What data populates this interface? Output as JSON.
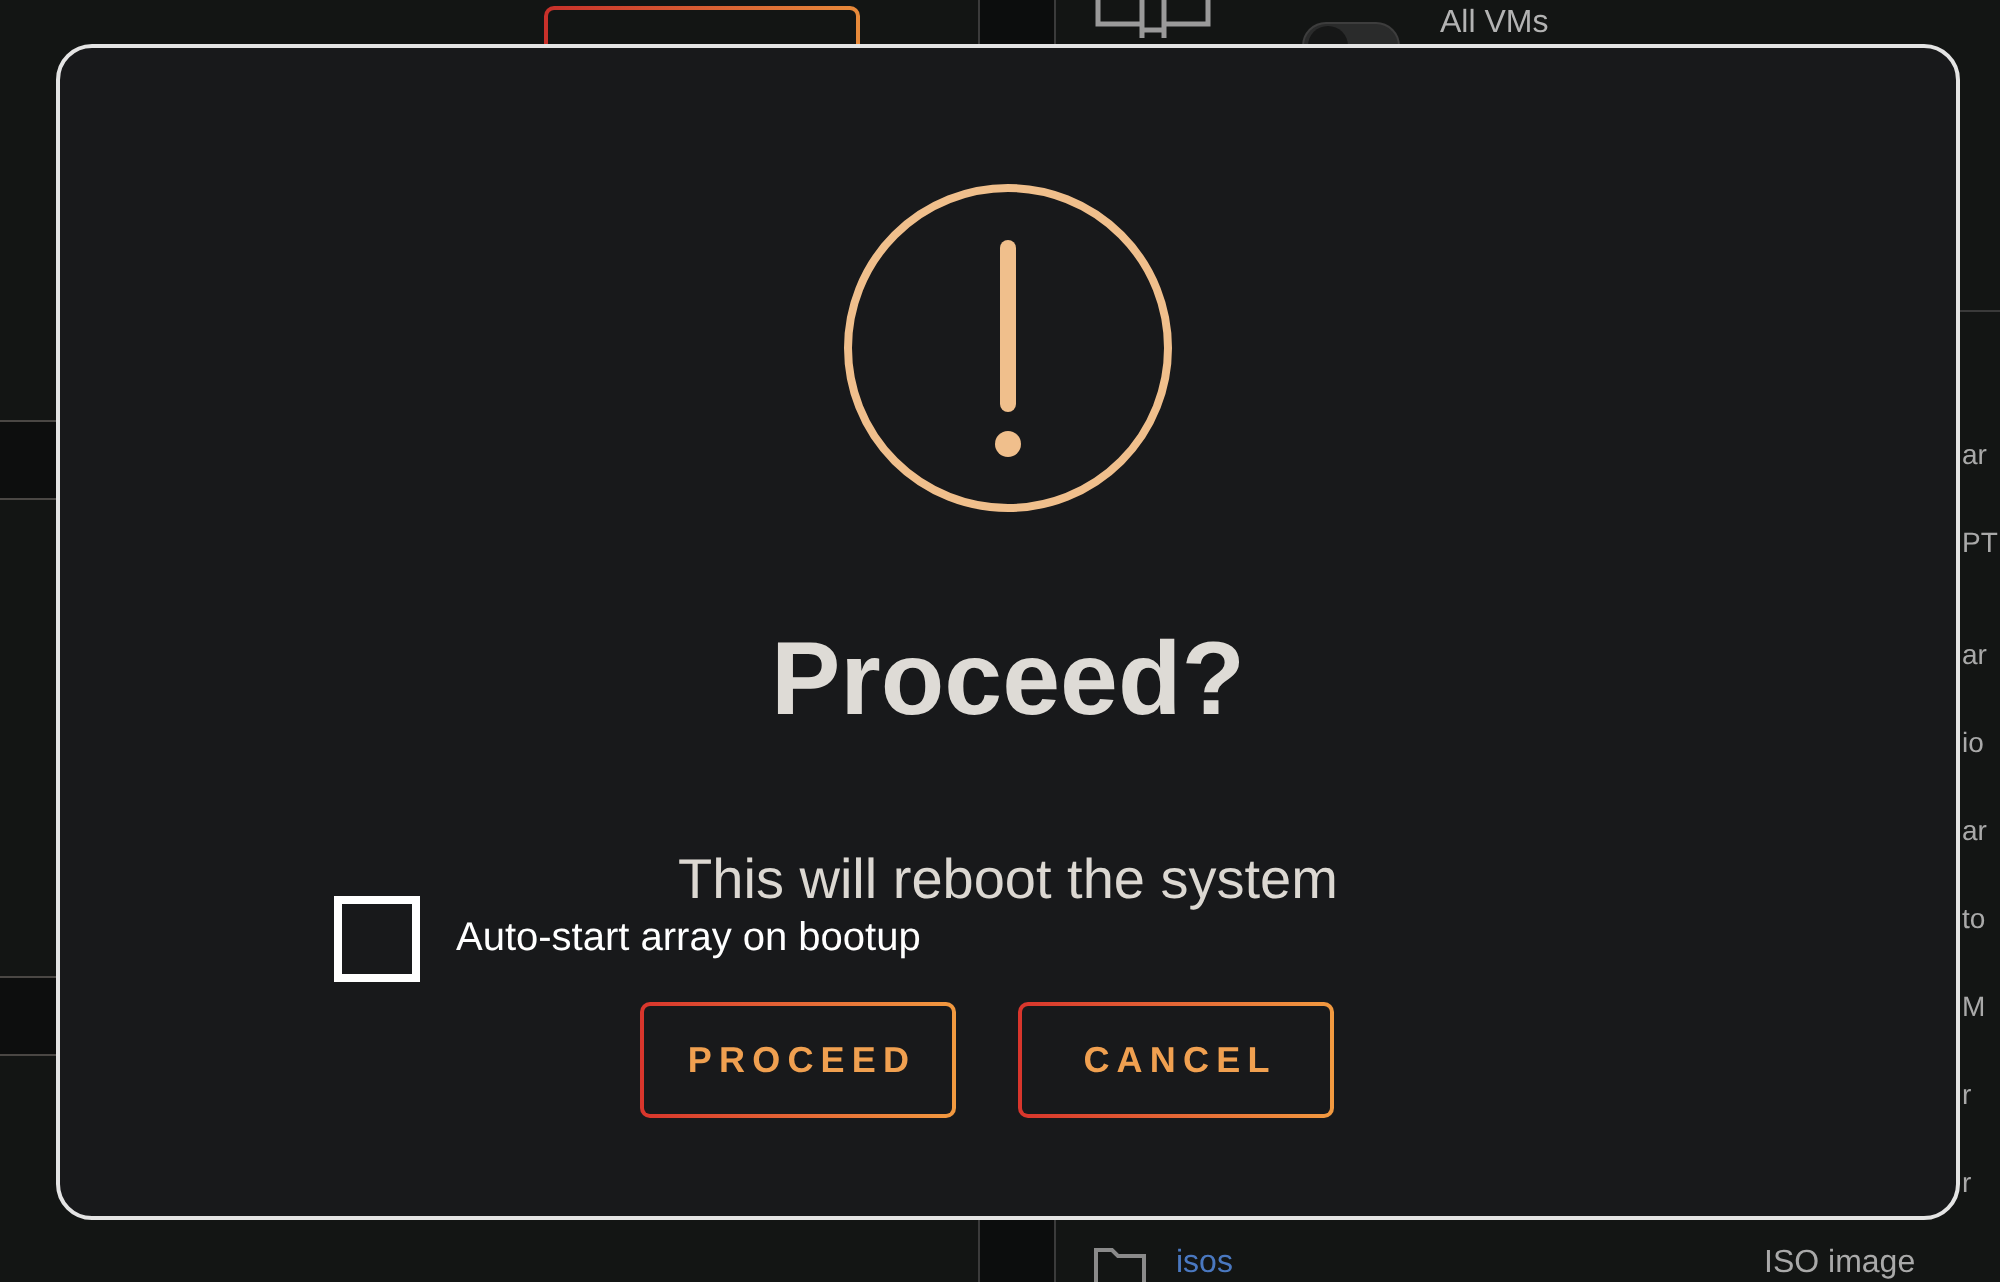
{
  "page": {
    "toolbar": {
      "toggle": {
        "on": false
      },
      "toggle_label": "All VMs"
    },
    "table_edge_fragments": [
      [
        "ar",
        "PT"
      ],
      [
        "ar",
        "io",
        "ar",
        "to",
        "M",
        "r",
        "r"
      ]
    ],
    "share_row": {
      "name": "isos",
      "description": "ISO image"
    }
  },
  "dialog": {
    "title": "Proceed?",
    "message": "This will reboot the system",
    "checkbox": {
      "label": "Auto-start array on bootup",
      "checked": false
    },
    "buttons": [
      "PROCEED",
      "CANCEL"
    ]
  }
}
